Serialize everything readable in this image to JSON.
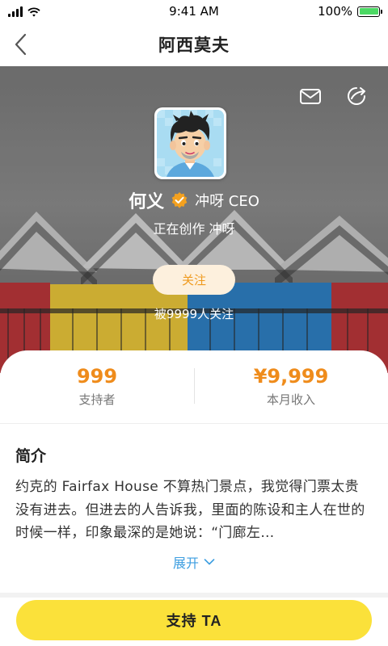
{
  "status_bar": {
    "time": "9:41 AM",
    "battery_text": "100%",
    "battery_level": 1.0,
    "battery_color": "#4cd964"
  },
  "nav": {
    "title": "阿西莫夫",
    "back_icon": "chevron-left-icon"
  },
  "profile": {
    "name": "何义",
    "verified_icon": "verified-badge-icon",
    "title": "冲呀 CEO",
    "status": "正在创作 冲呀",
    "follow_label": "关注",
    "followers_text": "被9999人关注",
    "actions": {
      "message_icon": "mail-icon",
      "share_icon": "share-icon"
    }
  },
  "stats": [
    {
      "value": "999",
      "label": "支持者"
    },
    {
      "value": "¥9,999",
      "label": "本月收入"
    }
  ],
  "intro": {
    "title": "简介",
    "text": "约克的 Fairfax House 不算热门景点，我觉得门票太贵没有进去。但进去的人告诉我，里面的陈设和主人在世的时候一样，印象最深的是她说：“门廊左…",
    "expand_label": "展开"
  },
  "bottom": {
    "support_label": "支持 TA"
  },
  "colors": {
    "accent_orange": "#ef8c1c",
    "link_blue": "#3d9ee0",
    "button_yellow": "#fbe13a",
    "follow_bg": "#fdf0dd"
  }
}
